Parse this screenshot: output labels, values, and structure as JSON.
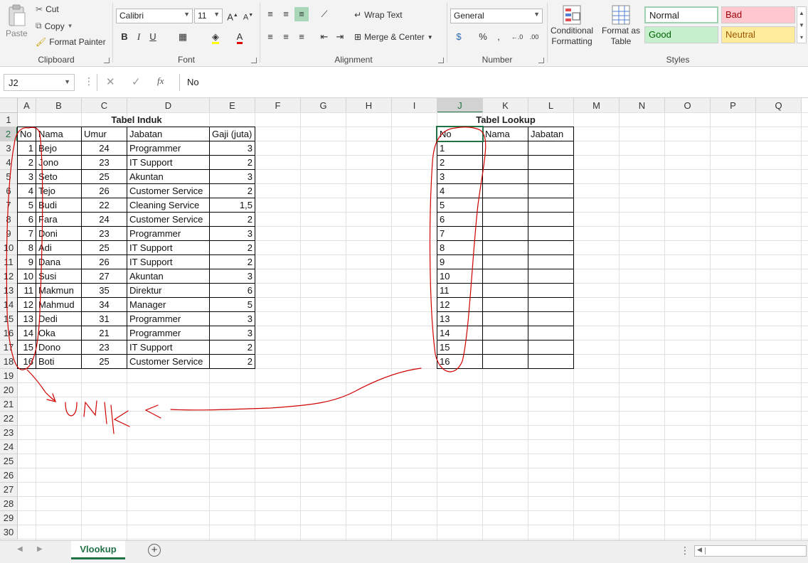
{
  "ribbon": {
    "clipboard": {
      "label": "Clipboard",
      "paste": "Paste",
      "cut": "Cut",
      "copy": "Copy",
      "format_painter": "Format Painter"
    },
    "font": {
      "label": "Font",
      "name": "Calibri",
      "size": "11"
    },
    "alignment": {
      "label": "Alignment",
      "wrap_text": "Wrap Text",
      "merge_center": "Merge & Center"
    },
    "number": {
      "label": "Number",
      "format": "General"
    },
    "styles": {
      "label": "Styles",
      "conditional_formatting_1": "Conditional",
      "conditional_formatting_2": "Formatting",
      "format_as_table_1": "Format as",
      "format_as_table_2": "Table",
      "normal": "Normal",
      "bad": "Bad",
      "good": "Good",
      "neutral": "Neutral"
    }
  },
  "formula_bar": {
    "name_box": "J2",
    "content": "No"
  },
  "columns": [
    "A",
    "B",
    "C",
    "D",
    "E",
    "F",
    "G",
    "H",
    "I",
    "J",
    "K",
    "L",
    "M",
    "N",
    "O",
    "P",
    "Q"
  ],
  "rows": [
    "1",
    "2",
    "3",
    "4",
    "5",
    "6",
    "7",
    "8",
    "9",
    "10",
    "11",
    "12",
    "13",
    "14",
    "15",
    "16",
    "17",
    "18",
    "19",
    "20",
    "21",
    "22",
    "23",
    "24",
    "25",
    "26",
    "27",
    "28",
    "29",
    "30"
  ],
  "main_table": {
    "title": "Tabel Induk",
    "headers": [
      "No",
      "Nama",
      "Umur",
      "Jabatan",
      "Gaji (juta)"
    ],
    "rows": [
      [
        "1",
        "Bejo",
        "24",
        "Programmer",
        "3"
      ],
      [
        "2",
        "Jono",
        "23",
        "IT Support",
        "2"
      ],
      [
        "3",
        "Seto",
        "25",
        "Akuntan",
        "3"
      ],
      [
        "4",
        "Tejo",
        "26",
        "Customer Service",
        "2"
      ],
      [
        "5",
        "Budi",
        "22",
        "Cleaning Service",
        "1,5"
      ],
      [
        "6",
        "Fara",
        "24",
        "Customer Service",
        "2"
      ],
      [
        "7",
        "Doni",
        "23",
        "Programmer",
        "3"
      ],
      [
        "8",
        "Adi",
        "25",
        "IT Support",
        "2"
      ],
      [
        "9",
        "Dana",
        "26",
        "IT Support",
        "2"
      ],
      [
        "10",
        "Susi",
        "27",
        "Akuntan",
        "3"
      ],
      [
        "11",
        "Makmun",
        "35",
        "Direktur",
        "6"
      ],
      [
        "12",
        "Mahmud",
        "34",
        "Manager",
        "5"
      ],
      [
        "13",
        "Dedi",
        "31",
        "Programmer",
        "3"
      ],
      [
        "14",
        "Oka",
        "21",
        "Programmer",
        "3"
      ],
      [
        "15",
        "Dono",
        "23",
        "IT Support",
        "2"
      ],
      [
        "16",
        "Boti",
        "25",
        "Customer Service",
        "2"
      ]
    ]
  },
  "lookup_table": {
    "title": "Tabel Lookup",
    "headers": [
      "No",
      "Nama",
      "Jabatan"
    ],
    "rows": [
      "1",
      "2",
      "3",
      "4",
      "5",
      "6",
      "7",
      "8",
      "9",
      "10",
      "11",
      "12",
      "13",
      "14",
      "15",
      "16"
    ]
  },
  "annotation": {
    "text": "UNIK",
    "color": "#d00000"
  },
  "sheet_tabs": {
    "active": "Vlookup"
  },
  "colors": {
    "accent": "#217346",
    "bad_bg": "#ffc7ce",
    "bad_fg": "#9c0006",
    "good_bg": "#c6efce",
    "good_fg": "#006100",
    "neutral_bg": "#ffeb9c",
    "neutral_fg": "#9c5700"
  }
}
